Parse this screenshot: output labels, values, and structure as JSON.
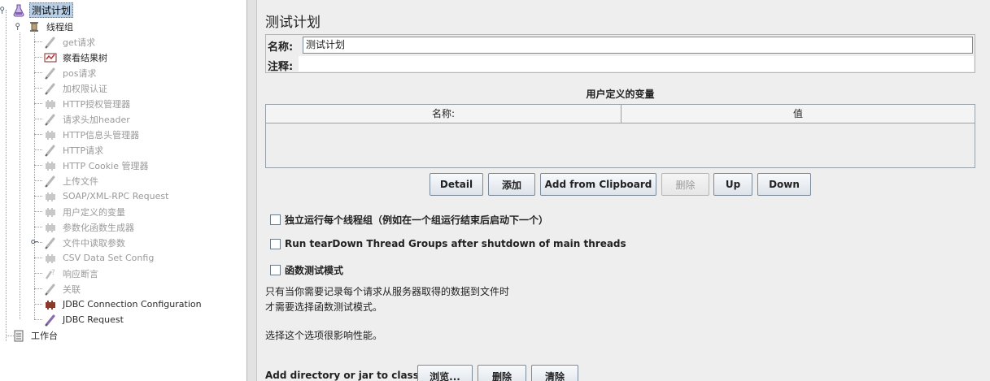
{
  "tree": {
    "root": "测试计划",
    "thread_group": "线程组",
    "items": [
      {
        "label": "get请求",
        "disabled": true
      },
      {
        "label": "察看结果树",
        "disabled": false
      },
      {
        "label": "pos请求",
        "disabled": true
      },
      {
        "label": "加权限认证",
        "disabled": true
      },
      {
        "label": "HTTP授权管理器",
        "disabled": true
      },
      {
        "label": "请求头加header",
        "disabled": true
      },
      {
        "label": "HTTP信息头管理器",
        "disabled": true
      },
      {
        "label": "HTTP请求",
        "disabled": true
      },
      {
        "label": "HTTP Cookie 管理器",
        "disabled": true
      },
      {
        "label": "上传文件",
        "disabled": true
      },
      {
        "label": "SOAP/XML-RPC Request",
        "disabled": true
      },
      {
        "label": "用户定义的变量",
        "disabled": true
      },
      {
        "label": "参数化函数生成器",
        "disabled": true
      },
      {
        "label": "文件中读取参数",
        "disabled": true
      },
      {
        "label": "CSV Data Set Config",
        "disabled": true
      },
      {
        "label": "响应断言",
        "disabled": true
      },
      {
        "label": "关联",
        "disabled": true
      },
      {
        "label": "JDBC Connection Configuration",
        "disabled": false
      },
      {
        "label": "JDBC Request",
        "disabled": false
      }
    ],
    "workbench": "工作台"
  },
  "panel": {
    "title": "测试计划",
    "name_label": "名称:",
    "name_value": "测试计划",
    "comment_label": "注释:",
    "comment_value": "",
    "vars_title": "用户定义的变量",
    "col_name": "名称:",
    "col_value": "值",
    "buttons": {
      "detail": "Detail",
      "add": "添加",
      "add_clipboard": "Add from Clipboard",
      "delete": "删除",
      "up": "Up",
      "down": "Down"
    },
    "cb_independent": "独立运行每个线程组（例如在一个组运行结束后启动下一个）",
    "cb_teardown": "Run tearDown Thread Groups after shutdown of main threads",
    "cb_functional": "函数测试模式",
    "note_line1": "只有当你需要记录每个请求从服务器取得的数据到文件时",
    "note_line2": "才需要选择函数测试模式。",
    "note_line3": "选择这个选项很影响性能。",
    "classpath_label": "Add directory or jar to classpath",
    "classpath_buttons": {
      "browse": "浏览...",
      "delete": "删除",
      "clear": "清除"
    }
  }
}
